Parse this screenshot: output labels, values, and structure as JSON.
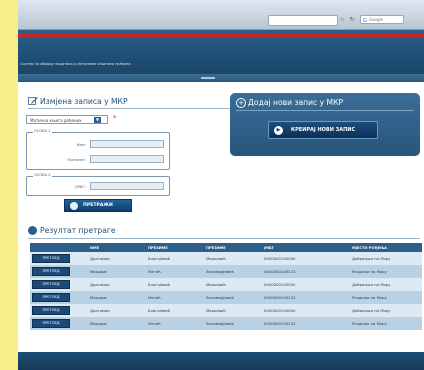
{
  "browser": {
    "search_placeholder": "Google",
    "search_engine_icon": "google-g-icon",
    "nav_icons": [
      "star-icon",
      "refresh-icon"
    ]
  },
  "header": {
    "tagline": "Систем за обраду података о матичним књигама грађана"
  },
  "edit_panel": {
    "title": "Измјена записа у МКР",
    "select_value": "Матична књига рођених",
    "required_mark": "*",
    "group1_legend": "ОСОБА 1",
    "group1_fields": [
      {
        "label": "Име:",
        "value": ""
      },
      {
        "label": "Презиме:",
        "value": ""
      },
      {
        "label": "ЈМБГ:",
        "value": ""
      }
    ],
    "group2_legend": "ОСОБА 2",
    "group2_fields": [
      {
        "label": "ЈМБГ:",
        "value": ""
      }
    ],
    "search_button": "ПРЕТРАЖИ"
  },
  "add_panel": {
    "title": "Додај нови запис у МКР",
    "create_button": "КРЕИРАЈ НОВИ ЗАПИС"
  },
  "results": {
    "title": "Резултат претраге",
    "columns": [
      "",
      "ИМЕ",
      "ПРЕЗИМЕ",
      "ПРЕЗИМЕ",
      "ЈМБГ",
      "МЈЕСТО РОЂЕЊА"
    ],
    "view_label": "ПРЕГЛЕД",
    "rows": [
      [
        "Драгомир",
        "Благојевић",
        "Марковић",
        "0000000100000",
        "Добрињци на Мору"
      ],
      [
        "Миодраг",
        "Матић",
        "Зелимирјевић",
        "0000000100224",
        "Раздоље на Мору"
      ],
      [
        "Драгомир",
        "Благојевић",
        "Марковић",
        "0000000100000",
        "Добрињци на Мору"
      ],
      [
        "Миодраг",
        "Матић",
        "Зелимирјевић",
        "0000000100224",
        "Раздоље на Мору"
      ],
      [
        "Драгомир",
        "Благојевић",
        "Марковић",
        "0000000100000",
        "Добрињци на Мору"
      ],
      [
        "Миодраг",
        "Матић",
        "Зелимирјевић",
        "0000000100224",
        "Раздоље на Мору"
      ]
    ]
  },
  "colors": {
    "brand_blue": "#1e4f78",
    "accent_red": "#c9272b",
    "row_light": "#dde9f3",
    "row_dark": "#b8d1e4"
  }
}
